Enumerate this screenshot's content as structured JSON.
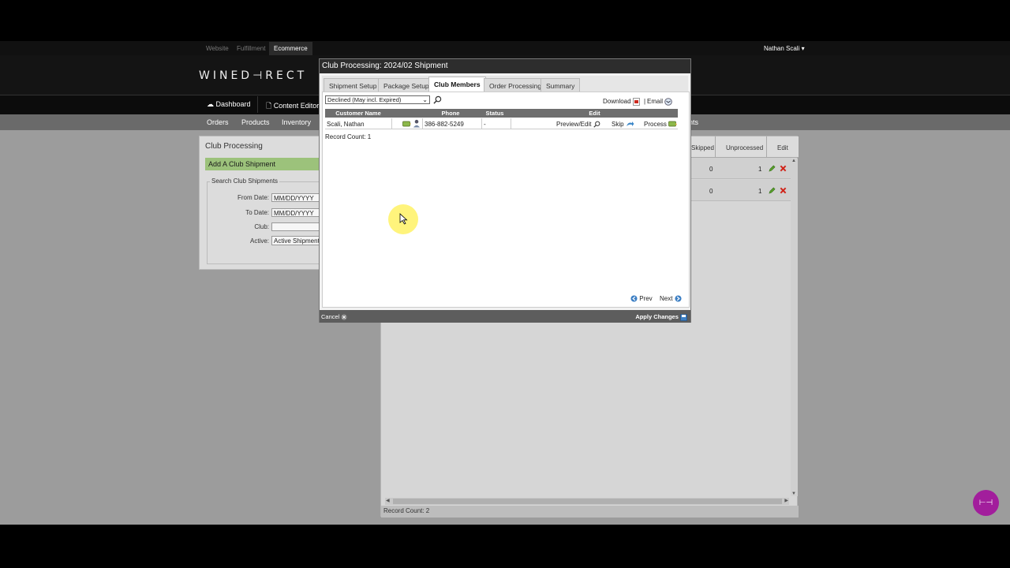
{
  "top_nav": {
    "links": [
      {
        "label": "Website"
      },
      {
        "label": "Fulfillment"
      },
      {
        "label": "Ecommerce",
        "active": true
      }
    ],
    "user": "Nathan Scali"
  },
  "header": {
    "logo": "WINED⊣RECT"
  },
  "main_nav": {
    "items": [
      {
        "label": "Dashboard",
        "icon": "cloud-icon"
      },
      {
        "label": "Content Editor",
        "icon": "document-icon"
      }
    ]
  },
  "sub_nav": {
    "items": [
      "Orders",
      "Products",
      "Inventory"
    ]
  },
  "left_panel": {
    "title": "Club Processing",
    "add_button": "Add A Club Shipment",
    "legend": "Search Club Shipments",
    "fields": [
      {
        "label": "From Date:",
        "value": "MM/DD/YYYY"
      },
      {
        "label": "To Date:",
        "value": "MM/DD/YYYY"
      },
      {
        "label": "Club:",
        "value": ""
      },
      {
        "label": "Active:",
        "value": "Active Shipments"
      }
    ]
  },
  "right_panel": {
    "columns": [
      "Skipped",
      "Unprocessed",
      "Edit"
    ],
    "rows": [
      {
        "skipped": "0",
        "unprocessed": "1"
      },
      {
        "skipped": "0",
        "unprocessed": "1"
      }
    ],
    "record_count": "Record Count: 2"
  },
  "modal": {
    "title": "Club Processing: 2024/02 Shipment",
    "tabs": [
      {
        "label": "Shipment Setup"
      },
      {
        "label": "Package Setup"
      },
      {
        "label": "Club Members",
        "active": true
      },
      {
        "label": "Order Processing"
      },
      {
        "label": "Summary"
      }
    ],
    "filter_value": "Declined (May incl. Expired)",
    "download_label": "Download",
    "email_label": "Email",
    "grid": {
      "headers": [
        "Customer Name",
        "Phone",
        "Status",
        "Edit"
      ],
      "rows": [
        {
          "name": "Scali, Nathan",
          "phone": "386-882-5249",
          "status": "-",
          "preview_edit": "Preview/Edit",
          "skip": "Skip",
          "process": "Process"
        }
      ]
    },
    "record_count": "Record Count: 1",
    "prev_label": "Prev",
    "next_label": "Next",
    "cancel_label": "Cancel",
    "apply_label": "Apply Changes"
  },
  "colors": {
    "accent_green": "#9cc27b",
    "modal_header": "#2d2d2d",
    "chat_bubble": "#a21e9c"
  }
}
